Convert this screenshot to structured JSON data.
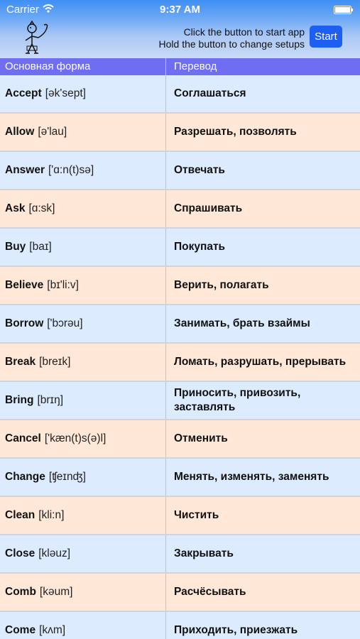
{
  "status": {
    "carrier": "Carrier",
    "time": "9:37 AM"
  },
  "header": {
    "hint_line1": "Click the button to start app",
    "hint_line2": "Hold the button to change setups",
    "start_label": "Start"
  },
  "columns": {
    "base_form": "Основная форма",
    "translation": "Перевод"
  },
  "rows": [
    {
      "word": "Accept",
      "transcription": "[ək'sept]",
      "translation": "Соглашаться"
    },
    {
      "word": "Allow",
      "transcription": "[ə'lau]",
      "translation": "Разрешать, позволять"
    },
    {
      "word": "Answer",
      "transcription": "['ɑ:n(t)sə]",
      "translation": "Отвечать"
    },
    {
      "word": "Ask",
      "transcription": "[ɑ:sk]",
      "translation": "Спрашивать"
    },
    {
      "word": "Buy",
      "transcription": "[baɪ]",
      "translation": "Покупать"
    },
    {
      "word": "Believe",
      "transcription": "[bɪ'li:v]",
      "translation": "Верить, полагать"
    },
    {
      "word": "Borrow",
      "transcription": "['bɔrəu]",
      "translation": "Занимать, брать взаймы"
    },
    {
      "word": "Break",
      "transcription": "[breɪk]",
      "translation": "Ломать, разрушать, прерывать"
    },
    {
      "word": "Bring",
      "transcription": "[brɪŋ]",
      "translation": "Приносить, привозить, заставлять"
    },
    {
      "word": "Cancel",
      "transcription": "['kæn(t)s(ə)l]",
      "translation": "Отменить"
    },
    {
      "word": "Change",
      "transcription": "[ʧeɪnʤ]",
      "translation": "Менять, изменять, заменять"
    },
    {
      "word": "Clean",
      "transcription": "[kli:n]",
      "translation": "Чистить"
    },
    {
      "word": "Close",
      "transcription": "[kləuz]",
      "translation": "Закрывать"
    },
    {
      "word": "Comb",
      "transcription": "[kəum]",
      "translation": "Расчёсывать"
    },
    {
      "word": "Come",
      "transcription": "[kʌm]",
      "translation": "Приходить, приезжать"
    }
  ]
}
